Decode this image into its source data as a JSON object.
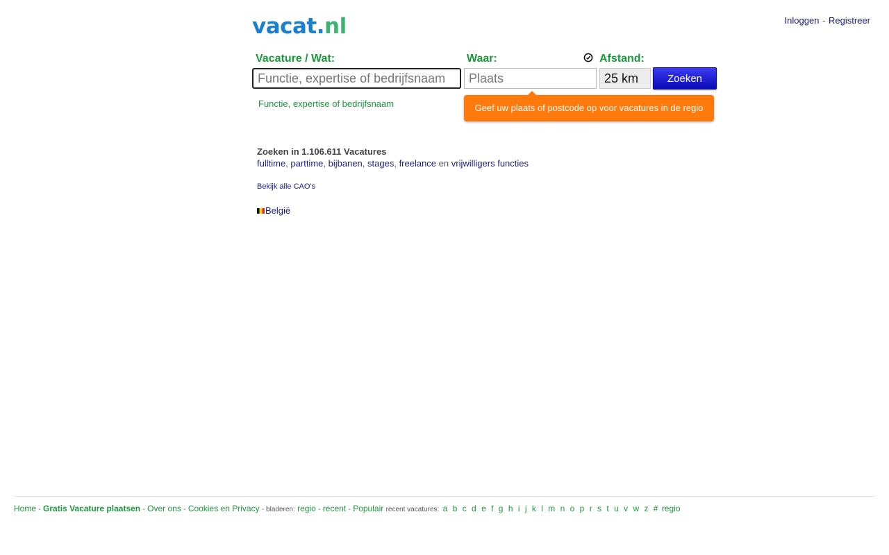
{
  "header": {
    "logo": {
      "main": "vacat",
      "dot": ".",
      "tld": "nl"
    },
    "login_label": "Inloggen",
    "separator": "-",
    "register_label": "Registreer"
  },
  "search": {
    "what_label": "Vacature / Wat:",
    "what_placeholder": "Functie, expertise of bedrijfsnaam",
    "what_hint": "Functie, expertise of bedrijfsnaam",
    "where_label": "Waar:",
    "where_placeholder": "Plaats",
    "distance_label": "Afstand:",
    "distance_value": "25 km",
    "button_label": "Zoeken",
    "tooltip": "Geef uw plaats of postcode op voor vacatures in de regio"
  },
  "info": {
    "count_text": "Zoeken in 1.106.611 Vacatures",
    "types": [
      "fulltime",
      "parttime",
      "bijbanen",
      "stages",
      "freelance"
    ],
    "connector": "en",
    "volunteer": "vrijwilligers functies",
    "cao_link": "Bekijk alle CAO's",
    "country_link": "België"
  },
  "footer": {
    "home": "Home",
    "post_job": "Gratis Vacature plaatsen",
    "about": "Over ons",
    "cookies": "Cookies en Privacy",
    "browse_label": "- bladeren:",
    "regio": "regio",
    "recent": "recent",
    "popular": "Populair",
    "recent_label": "recent vacatures:",
    "letters": [
      "a",
      "b",
      "c",
      "d",
      "e",
      "f",
      "g",
      "h",
      "i",
      "j",
      "k",
      "l",
      "m",
      "n",
      "o",
      "p",
      "r",
      "s",
      "t",
      "u",
      "v",
      "w",
      "z",
      "#"
    ],
    "regio_end": "regio",
    "dash": "-"
  },
  "colors": {
    "brand_green": "#1a9a3a",
    "link_blue": "#1a1a8c",
    "tooltip_orange": "#ff7a0c",
    "button_blue": "#1a1ad8"
  }
}
